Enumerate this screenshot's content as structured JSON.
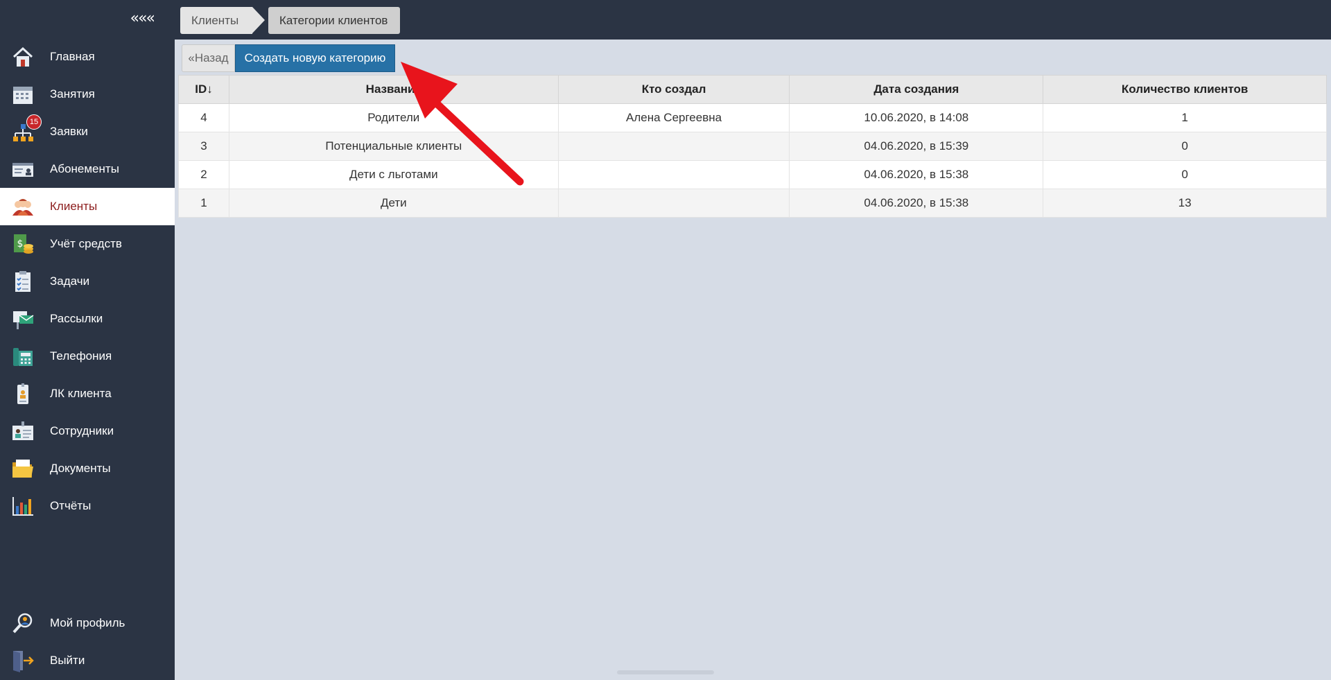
{
  "sidebar": {
    "collapse_label": "«««",
    "items": [
      {
        "label": "Главная",
        "icon": "home-icon"
      },
      {
        "label": "Занятия",
        "icon": "calendar-icon"
      },
      {
        "label": "Заявки",
        "icon": "requests-icon",
        "badge": "15"
      },
      {
        "label": "Абонементы",
        "icon": "subscription-card-icon"
      },
      {
        "label": "Клиенты",
        "icon": "clients-icon",
        "active": true
      },
      {
        "label": "Учёт средств",
        "icon": "money-icon"
      },
      {
        "label": "Задачи",
        "icon": "tasks-icon"
      },
      {
        "label": "Рассылки",
        "icon": "mailing-icon"
      },
      {
        "label": "Телефония",
        "icon": "phone-icon"
      },
      {
        "label": "ЛК клиента",
        "icon": "client-account-icon"
      },
      {
        "label": "Сотрудники",
        "icon": "employees-icon"
      },
      {
        "label": "Документы",
        "icon": "documents-icon"
      },
      {
        "label": "Отчёты",
        "icon": "reports-icon"
      }
    ],
    "bottom_items": [
      {
        "label": "Мой профиль",
        "icon": "profile-icon"
      },
      {
        "label": "Выйти",
        "icon": "logout-icon"
      }
    ]
  },
  "breadcrumb": [
    "Клиенты",
    "Категории клиентов"
  ],
  "actions": {
    "back": "«Назад",
    "create": "Создать новую категорию"
  },
  "table": {
    "headers": [
      "ID↓",
      "Название",
      "Кто создал",
      "Дата создания",
      "Количество клиентов"
    ],
    "rows": [
      [
        "4",
        "Родители",
        "Алена Сергеевна",
        "10.06.2020, в 14:08",
        "1"
      ],
      [
        "3",
        "Потенциальные клиенты",
        "",
        "04.06.2020, в 15:39",
        "0"
      ],
      [
        "2",
        "Дети с льготами",
        "",
        "04.06.2020, в 15:38",
        "0"
      ],
      [
        "1",
        "Дети",
        "",
        "04.06.2020, в 15:38",
        "13"
      ]
    ]
  },
  "colors": {
    "sidebar": "#2b3444",
    "primary_button": "#2771a6",
    "active_text": "#8c1d1d",
    "annotation_arrow": "#e8141c",
    "badge": "#c8262a"
  }
}
